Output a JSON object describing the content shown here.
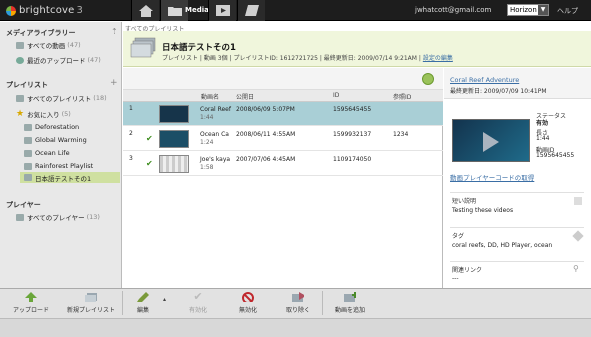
{
  "app": {
    "brand": "brightcove",
    "version": "3",
    "nav_media_label": "Media",
    "user_email": "jwhatcott@gmail.com",
    "account": "Horizon",
    "help": "ヘルプ"
  },
  "sidebar": {
    "media_library_title": "メディアライブラリー",
    "all_videos": "すべての動画",
    "all_videos_count": "(47)",
    "recent_uploads": "最近のアップロード",
    "recent_uploads_count": "(47)",
    "playlists_title": "プレイリスト",
    "all_playlists": "すべてのプレイリスト",
    "all_playlists_count": "(18)",
    "favorites": "お気に入り",
    "favorites_count": "(5)",
    "favorite_items": [
      "Deforestation",
      "Global Warming",
      "Ocean Life",
      "Rainforest Playlist",
      "日本語テストその1"
    ],
    "players_title": "プレイヤー",
    "all_players": "すべてのプレイヤー",
    "all_players_count": "(13)"
  },
  "header": {
    "breadcrumb": "すべてのプレイリスト",
    "title": "日本語テストその1",
    "meta_type": "プレイリスト",
    "meta_count": "動画 3個",
    "meta_id": "プレイリストID: 1612721725",
    "meta_updated": "最終更新日: 2009/07/14 9:21AM",
    "meta_settings": "設定の編集"
  },
  "table": {
    "columns": [
      "動画名",
      "公開日",
      "ID",
      "参照ID"
    ],
    "rows": [
      {
        "num": "1",
        "check": "",
        "name": "Coral Reef",
        "duration": "1:44",
        "date": "2008/06/09 5:07PM",
        "id": "1595645455",
        "ref": ""
      },
      {
        "num": "2",
        "check": "✔",
        "name": "Ocean Ca",
        "duration": "1:24",
        "date": "2008/06/11 4:55AM",
        "id": "1599932137",
        "ref": "1234"
      },
      {
        "num": "3",
        "check": "✔",
        "name": "Joe's kaya",
        "duration": "1:58",
        "date": "2007/07/06 4:45AM",
        "id": "1109174050",
        "ref": ""
      }
    ]
  },
  "details": {
    "title": "Coral Reef Adventure",
    "updated": "最終更新日: 2009/07/09 10:41PM",
    "status_label": "ステータス",
    "status_value": "有効",
    "length_label": "長さ",
    "length_value": "1:44",
    "video_id_label": "動画ID",
    "video_id_value": "1595645455",
    "player_code_link": "動画プレイヤーコードの取得",
    "short_desc_label": "短い説明",
    "short_desc_value": "Testing these videos",
    "tags_label": "タグ",
    "tags_value": "coral reefs, DD, HD Player, ocean",
    "related_link_label": "関連リンク",
    "related_link_value": "---"
  },
  "toolbar": {
    "upload": "アップロード",
    "new_playlist": "新規プレイリスト",
    "edit": "編集",
    "activate": "有効化",
    "deactivate": "無効化",
    "remove": "取り除く",
    "add_video": "動画を追加"
  }
}
